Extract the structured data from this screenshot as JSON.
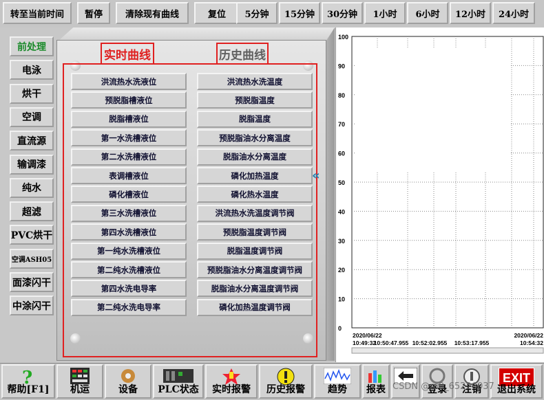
{
  "toolbar": {
    "left_buttons": [
      "转至当前时间",
      "暂停",
      "清除现有曲线",
      "复位"
    ],
    "range_buttons": [
      "5分钟",
      "15分钟",
      "30分钟",
      "1小时",
      "6小时",
      "12小时",
      "24小时"
    ]
  },
  "sidebar": {
    "items": [
      "前处理",
      "电泳",
      "烘干",
      "空调",
      "直流源",
      "输调漆",
      "纯水",
      "超滤",
      "PVC烘干",
      "空调ASH05",
      "面漆闪干",
      "中涂闪干"
    ],
    "active_index": 0
  },
  "tabs": {
    "realtime": "实时曲线",
    "history": "历史曲线"
  },
  "curve_buttons": {
    "left": [
      "洪流热水洗液位",
      "预脱脂槽液位",
      "脱脂槽液位",
      "第一水洗槽液位",
      "第二水洗槽液位",
      "表调槽液位",
      "磷化槽液位",
      "第三水洗槽液位",
      "第四水洗槽液位",
      "第一纯水洗槽液位",
      "第二纯水洗槽液位",
      "第四水洗电导率",
      "第二纯水洗电导率"
    ],
    "right": [
      "洪流热水洗温度",
      "预脱脂温度",
      "脱脂温度",
      "预脱脂油水分离温度",
      "脱脂油水分离温度",
      "磷化加热温度",
      "磷化热水温度",
      "洪流热水洗温度调节阀",
      "预脱脂温度调节阀",
      "脱脂温度调节阀",
      "预脱脂油水分离温度调节阀",
      "脱脂油水分离温度调节阀",
      "磷化加热温度调节阀"
    ]
  },
  "collapse_arrow": "«",
  "chart_data": {
    "type": "line",
    "ylim": [
      0,
      100
    ],
    "y_ticks": [
      "100",
      "90",
      "80",
      "70",
      "60",
      "50",
      "40",
      "30",
      "20",
      "10",
      "0"
    ],
    "x_date_left": "2020/06/22",
    "x_date_right": "2020/06/22",
    "x_ticks": [
      "10:49:32",
      "10:50:47.955",
      "10:52:02.955",
      "10:53:17.955",
      "10:54:32"
    ],
    "series": [],
    "grid": true
  },
  "bottom": {
    "buttons": [
      "帮助[F1]",
      "机运",
      "设备",
      "PLC状态",
      "实时报警",
      "历史报警",
      "趋势",
      "报表",
      "",
      "登录",
      "注销",
      "退出系统"
    ],
    "exit_icon_text": "EXIT"
  },
  "watermark": "CSDN @m0_65226037"
}
